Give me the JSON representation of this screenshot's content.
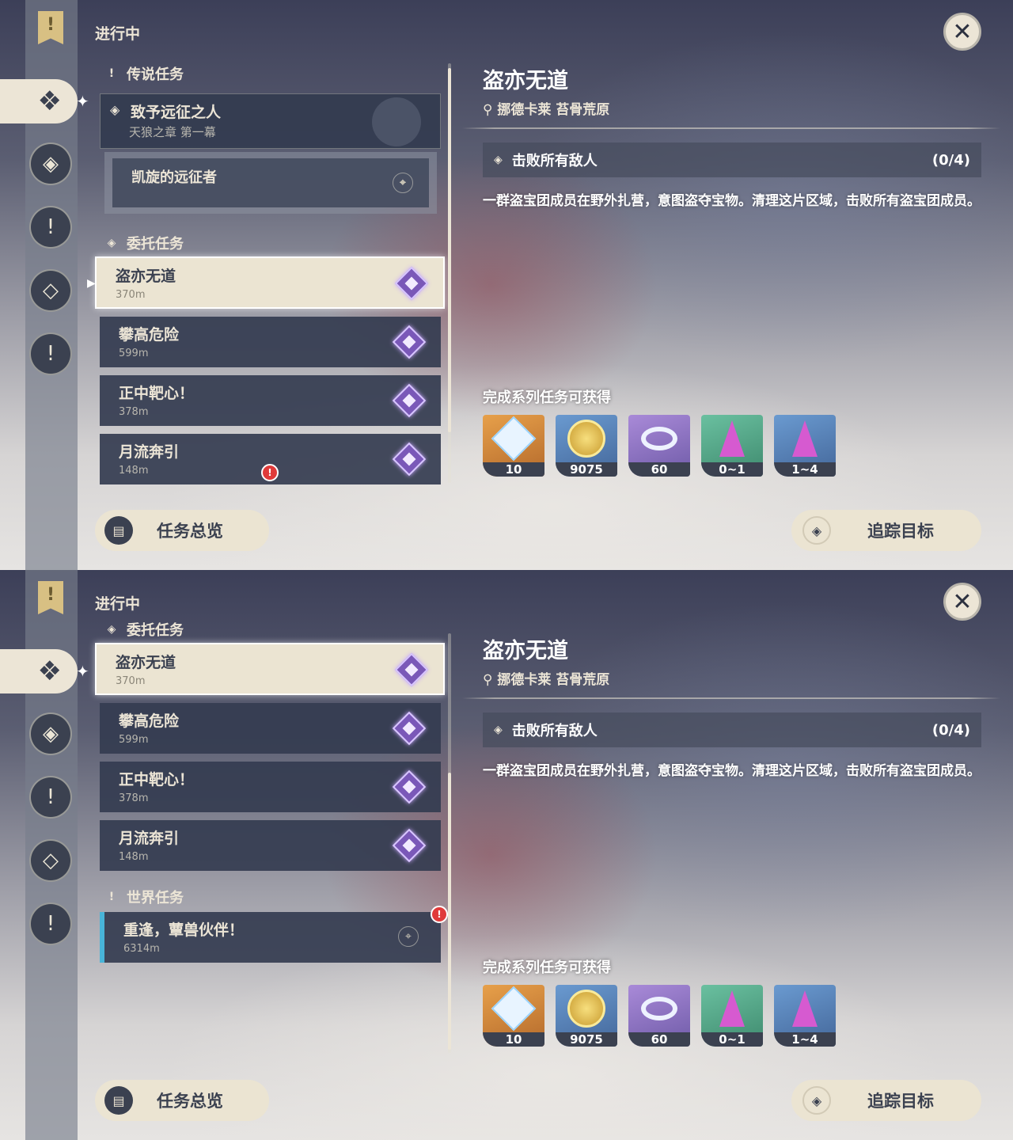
{
  "header": {
    "in_progress": "进行中"
  },
  "sections": {
    "legend": "传说任务",
    "commission": "委托任务",
    "world": "世界任务"
  },
  "legend_quest": {
    "title": "致予远征之人",
    "chapter": "天狼之章 第一幕",
    "sub": "凯旋的远征者"
  },
  "commissions": [
    {
      "title": "盗亦无道",
      "distance": "370m"
    },
    {
      "title": "攀高危险",
      "distance": "599m"
    },
    {
      "title": "正中靶心！",
      "distance": "378m"
    },
    {
      "title": "月流奔引",
      "distance": "148m"
    }
  ],
  "world_quest": {
    "title": "重逢，蕈兽伙伴！",
    "distance": "6314m"
  },
  "detail": {
    "title": "盗亦无道",
    "location": "挪德卡莱 苔骨荒原",
    "objective": "击败所有敌人",
    "objective_count": "(0/4)",
    "description": "一群盗宝团成员在野外扎营，意图盗夺宝物。清理这片区域，击败所有盗宝团成员。",
    "rewards_title": "完成系列任务可获得",
    "rewards": [
      {
        "icon": "primogem-icon",
        "count": "10"
      },
      {
        "icon": "mora-icon",
        "count": "9075"
      },
      {
        "icon": "companionship-exp-icon",
        "count": "60"
      },
      {
        "icon": "crystal-icon",
        "count": "0~1"
      },
      {
        "icon": "crystal-cluster-icon",
        "count": "1~4"
      }
    ]
  },
  "buttons": {
    "overview": "任务总览",
    "track": "追踪目标"
  },
  "colors": {
    "accent": "#ebe4d2",
    "card": "#343c50",
    "world_marker": "#48b4d8",
    "alert": "#e03a3a"
  }
}
